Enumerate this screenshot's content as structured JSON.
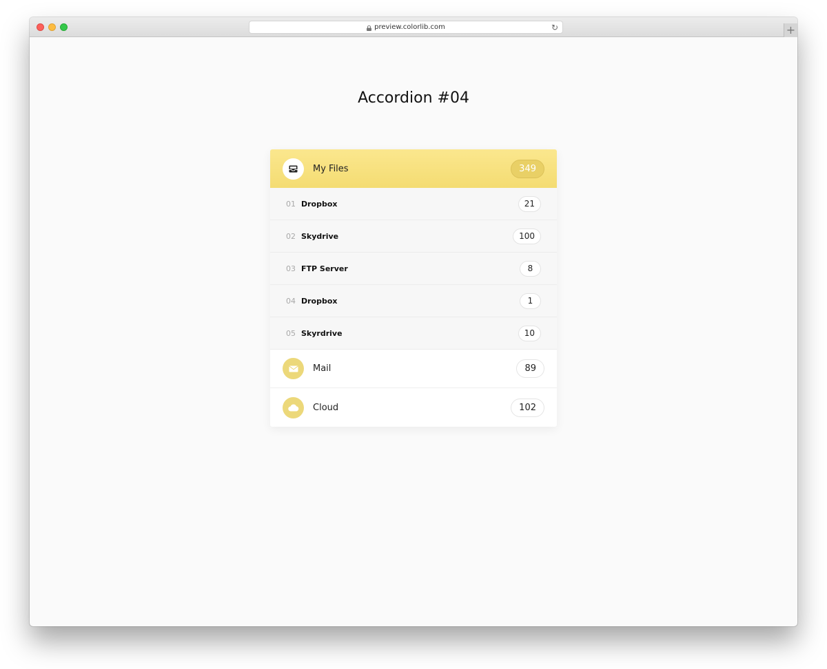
{
  "browser": {
    "url": "preview.colorlib.com",
    "newtab_symbol": "+",
    "reload_symbol": "↻"
  },
  "page": {
    "title": "Accordion #04"
  },
  "accordion": {
    "header": {
      "label": "My Files",
      "count": "349",
      "icon": "inbox-icon"
    },
    "subitems": [
      {
        "num": "01",
        "label": "Dropbox",
        "count": "21"
      },
      {
        "num": "02",
        "label": "Skydrive",
        "count": "100"
      },
      {
        "num": "03",
        "label": "FTP Server",
        "count": "8"
      },
      {
        "num": "04",
        "label": "Dropbox",
        "count": "1"
      },
      {
        "num": "05",
        "label": "Skyrdrive",
        "count": "10"
      }
    ],
    "sections": [
      {
        "label": "Mail",
        "count": "89",
        "icon": "envelope-icon"
      },
      {
        "label": "Cloud",
        "count": "102",
        "icon": "cloud-icon"
      }
    ]
  },
  "colors": {
    "accent": "#f4dc72",
    "accent_dark": "#e9d066",
    "icon_circle": "#ecd87a"
  }
}
